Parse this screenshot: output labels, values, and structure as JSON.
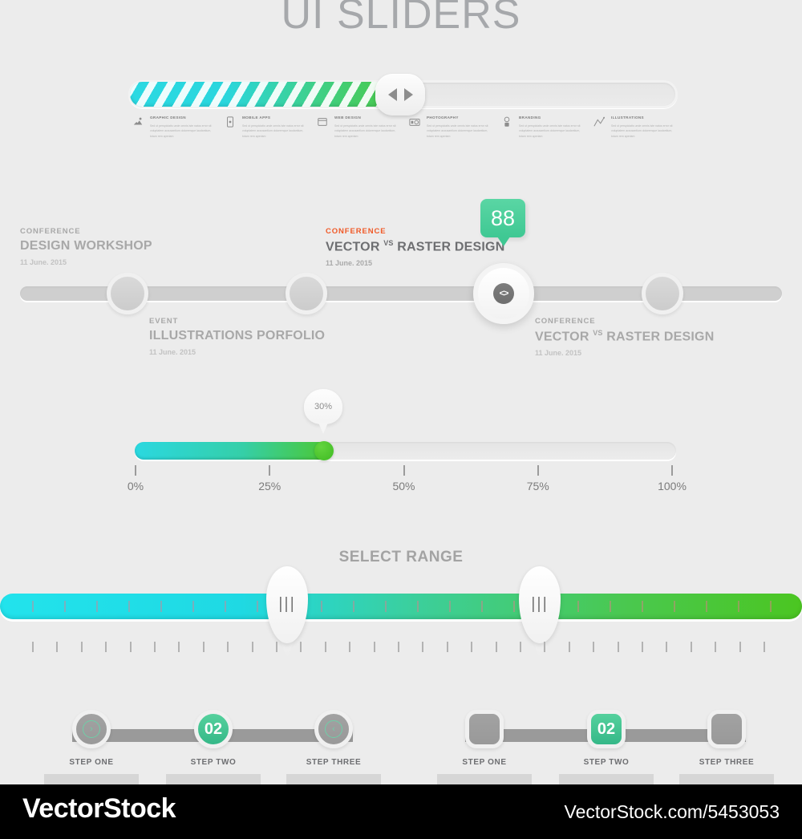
{
  "page": {
    "title": "UI SLIDERS",
    "background_color": "#ececec"
  },
  "striped_progress": {
    "name": "striped-progress-bar",
    "fill_percent": 50,
    "colors": {
      "start": "#2bd9e2",
      "end": "#4cc841",
      "track": "#e8e8e8"
    },
    "nav": {
      "prev_label": "prev",
      "next_label": "next"
    }
  },
  "categories": [
    {
      "icon": "graphic-design-icon",
      "title": "GRAPHIC DESIGN",
      "body": "Sed ut perspiciatis unde omnis iste natus error sit voluptatem accusantium doloremque laudantium, totam rem aperiam"
    },
    {
      "icon": "mobile-apps-icon",
      "title": "MOBILE APPS",
      "body": "Sed ut perspiciatis unde omnis iste natus error sit voluptatem accusantium doloremque laudantium, totam rem aperiam"
    },
    {
      "icon": "web-design-icon",
      "title": "WEB DESIGN",
      "body": "Sed ut perspiciatis unde omnis iste natus error sit voluptatem accusantium doloremque laudantium, totam rem aperiam"
    },
    {
      "icon": "photography-icon",
      "title": "PHOTOGRAPHY",
      "body": "Sed ut perspiciatis unde omnis iste natus error sit voluptatem accusantium doloremque laudantium, totam rem aperiam"
    },
    {
      "icon": "branding-icon",
      "title": "BRANDING",
      "body": "Sed ut perspiciatis unde omnis iste natus error sit voluptatem accusantium doloremque laudantium, totam rem aperiam"
    },
    {
      "icon": "illustrations-icon",
      "title": "ILLUSTRATIONS",
      "body": "Sed ut perspiciatis unde omnis iste natus error sit voluptatem accusantium doloremque laudantium, totam rem aperiam"
    }
  ],
  "timeline": {
    "badge": {
      "value": "88",
      "color": "#3fc893"
    },
    "handle_icon": "drag-handle-icon",
    "events": [
      {
        "kicker": "CONFERENCE",
        "name": "DESIGN WORKSHOP",
        "name_sup": "",
        "name_tail": "",
        "date": "11 June. 2015",
        "position": "above",
        "highlight": false
      },
      {
        "kicker": "EVENT",
        "name": "ILLUSTRATIONS PORFOLIO",
        "name_sup": "",
        "name_tail": "",
        "date": "11 June. 2015",
        "position": "below",
        "highlight": false
      },
      {
        "kicker": "CONFERENCE",
        "name": "VECTOR ",
        "name_sup": "VS",
        "name_tail": " RASTER DESIGN",
        "date": "11 June. 2015",
        "position": "above",
        "highlight": true
      },
      {
        "kicker": "CONFERENCE",
        "name": "VECTOR ",
        "name_sup": "VS",
        "name_tail": " RASTER DESIGN",
        "date": "11 June. 2015",
        "position": "below",
        "highlight": false
      }
    ]
  },
  "percent_slider": {
    "name": "percent-slider",
    "tooltip_value": "30%",
    "fill_percent": 36,
    "scale_labels": [
      "0%",
      "25%",
      "50%",
      "75%",
      "100%"
    ],
    "colors": {
      "start": "#2ad8e0",
      "end": "#4cc72f"
    }
  },
  "select_range": {
    "title": "SELECT RANGE",
    "handle_icon": "grip-lines-icon",
    "grip_glyph": "|||",
    "low_handle_percent": 35.8,
    "high_handle_percent": 67.3,
    "colors": {
      "start": "#22e3ec",
      "mid": "#3ccf9b",
      "end": "#4bc621"
    },
    "inner_tick_count": 24,
    "ruler_tick_count": 31
  },
  "step_groups": [
    {
      "shape": "circle",
      "steps": [
        {
          "label": "STEP ONE",
          "icon": "chevron-right-circle-icon",
          "glyph": "›",
          "active": false
        },
        {
          "label": "STEP TWO",
          "icon": "step-number-icon",
          "glyph": "02",
          "active": true
        },
        {
          "label": "STEP THREE",
          "icon": "chevron-left-circle-icon",
          "glyph": "‹",
          "active": false
        }
      ]
    },
    {
      "shape": "rounded-square",
      "steps": [
        {
          "label": "STEP ONE",
          "icon": "",
          "glyph": "",
          "active": false
        },
        {
          "label": "STEP TWO",
          "icon": "step-number-icon",
          "glyph": "02",
          "active": true
        },
        {
          "label": "STEP THREE",
          "icon": "",
          "glyph": "",
          "active": false
        }
      ]
    }
  ],
  "footer": {
    "brand": "VectorStock",
    "url": "VectorStock.com/5453053"
  }
}
